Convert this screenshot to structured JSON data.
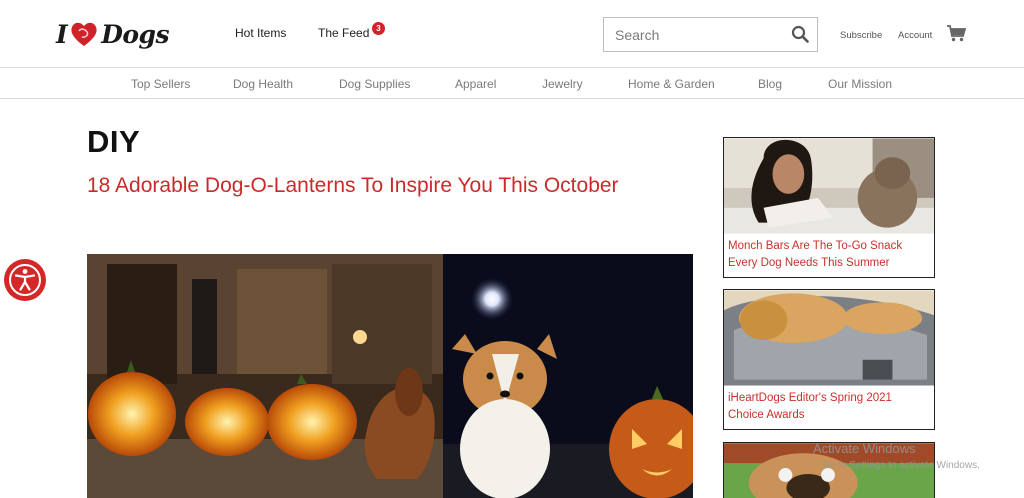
{
  "header": {
    "logo": {
      "text_i": "I",
      "text_dogs": "Dogs",
      "heart_icon": "heart-icon"
    },
    "nav": [
      {
        "label": "Hot Items"
      },
      {
        "label": "The Feed",
        "badge": "3"
      }
    ],
    "search": {
      "placeholder": "Search",
      "value": "",
      "icon": "search-icon"
    },
    "links": {
      "subscribe": "Subscribe",
      "account": "Account",
      "cart_icon": "cart-icon"
    }
  },
  "categories": [
    "Top Sellers",
    "Dog Health",
    "Dog Supplies",
    "Apparel",
    "Jewelry",
    "Home & Garden",
    "Blog",
    "Our Mission"
  ],
  "main": {
    "section_title": "DIY",
    "article_title": "18 Adorable Dog-O-Lanterns To Inspire You This October"
  },
  "sidebar": {
    "cards": [
      {
        "caption": "Monch Bars Are The To-Go Snack Every Dog Needs This Summer"
      },
      {
        "caption": "iHeartDogs Editor's Spring 2021 Choice Awards"
      },
      {
        "caption": ""
      }
    ]
  },
  "overlay": {
    "watermark_title": "Activate Windows",
    "watermark_sub": "Go to Settings to activate Windows."
  },
  "colors": {
    "accent": "#cc2a2a",
    "badge": "#d0222a",
    "a11y": "#d42828"
  }
}
